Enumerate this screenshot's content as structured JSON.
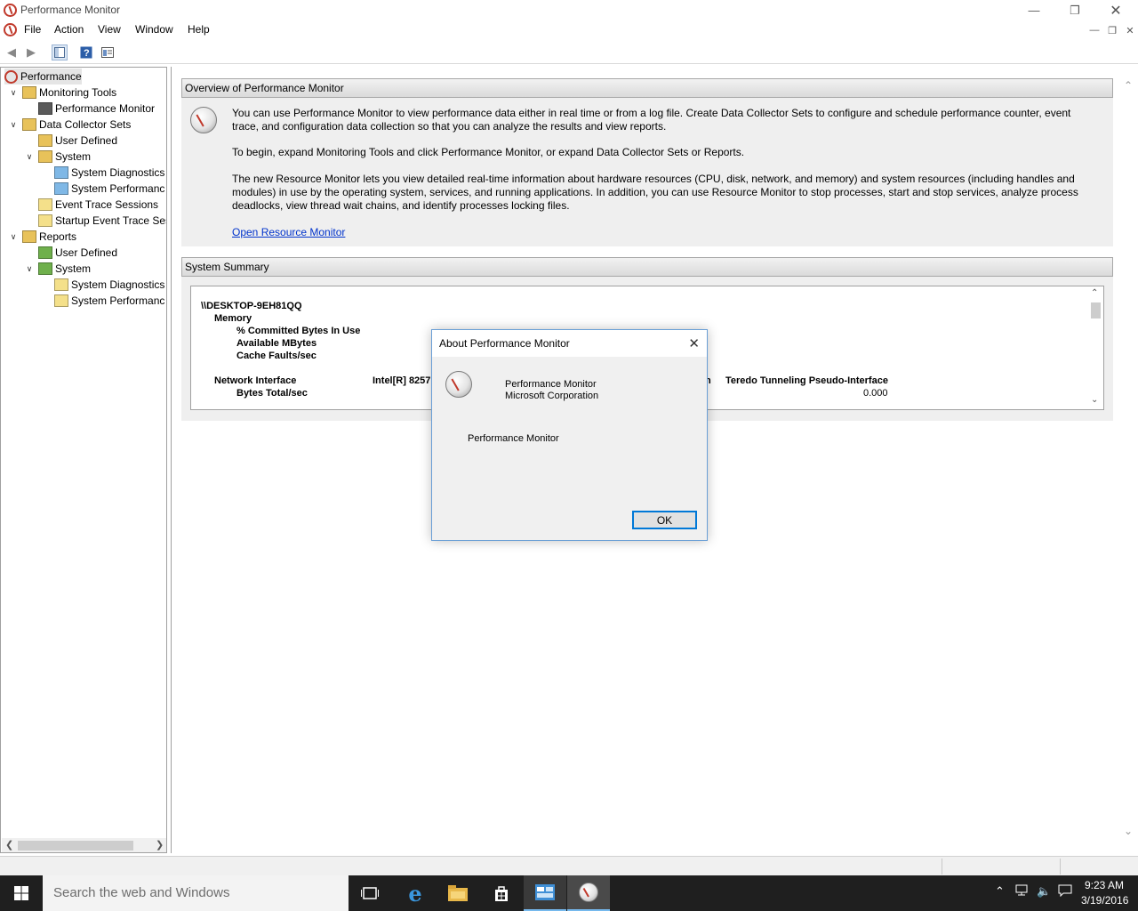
{
  "window": {
    "title": "Performance Monitor"
  },
  "menu": [
    "File",
    "Action",
    "View",
    "Window",
    "Help"
  ],
  "tree": [
    {
      "label": "Performance",
      "level": 0,
      "twisty": "",
      "selected": true,
      "icon": "perfmon-icon"
    },
    {
      "label": "Monitoring Tools",
      "level": 1,
      "twisty": "v",
      "icon": "monitoring-tools-icon"
    },
    {
      "label": "Performance Monitor",
      "level": 2,
      "twisty": "",
      "icon": "chart-icon"
    },
    {
      "label": "Data Collector Sets",
      "level": 1,
      "twisty": "v",
      "icon": "data-collector-icon"
    },
    {
      "label": "User Defined",
      "level": 2,
      "twisty": "",
      "icon": "user-folder-icon"
    },
    {
      "label": "System",
      "level": 2,
      "twisty": "v",
      "icon": "system-folder-icon"
    },
    {
      "label": "System Diagnostics",
      "level": 3,
      "twisty": "",
      "icon": "collector-icon"
    },
    {
      "label": "System Performanc",
      "level": 3,
      "twisty": "",
      "icon": "collector-icon"
    },
    {
      "label": "Event Trace Sessions",
      "level": 2,
      "twisty": "",
      "icon": "folder-icon"
    },
    {
      "label": "Startup Event Trace Ses",
      "level": 2,
      "twisty": "",
      "icon": "folder-icon"
    },
    {
      "label": "Reports",
      "level": 1,
      "twisty": "v",
      "icon": "reports-icon"
    },
    {
      "label": "User Defined",
      "level": 2,
      "twisty": "",
      "icon": "report-folder-icon"
    },
    {
      "label": "System",
      "level": 2,
      "twisty": "v",
      "icon": "report-folder-icon"
    },
    {
      "label": "System Diagnostics",
      "level": 3,
      "twisty": "",
      "icon": "report-icon"
    },
    {
      "label": "System Performanc",
      "level": 3,
      "twisty": "",
      "icon": "report-icon"
    }
  ],
  "overview": {
    "header": "Overview of Performance Monitor",
    "p1": "You can use Performance Monitor to view performance data either in real time or from a log file. Create Data Collector Sets to configure and schedule performance counter, event trace, and configuration data collection so that you can analyze the results and view reports.",
    "p2": "To begin, expand Monitoring Tools and click Performance Monitor, or expand Data Collector Sets or Reports.",
    "p3": "The new Resource Monitor lets you view detailed real-time information about hardware resources (CPU, disk, network, and memory) and system resources (including handles and modules) in use by the operating system, services, and running applications. In addition, you can use Resource Monitor to stop processes, start and stop services, analyze process deadlocks, view thread wait chains, and identify processes locking files.",
    "link": "Open Resource Monitor"
  },
  "summary": {
    "header": "System Summary",
    "machine": "\\\\DESKTOP-9EH81QQ",
    "memory": "Memory",
    "committed": "% Committed Bytes In Use",
    "available": "Available MBytes",
    "cache": "Cache Faults/sec",
    "network": "Network Interface",
    "bytes_total": "Bytes Total/sec",
    "adapter1": "Intel[R] 8257",
    "adapter1_tail": "n",
    "adapter2": "Teredo Tunneling Pseudo-Interface",
    "adapter2_value": "0.000"
  },
  "dialog": {
    "title": "About Performance Monitor",
    "product": "Performance Monitor",
    "company": "Microsoft Corporation",
    "description": "Performance Monitor",
    "ok": "OK"
  },
  "taskbar": {
    "search_placeholder": "Search the web and Windows",
    "time": "9:23 AM",
    "date": "3/19/2016"
  },
  "colors": {
    "accent": "#0078d7",
    "link": "#0033cc",
    "taskbar": "#1f1f1f"
  }
}
